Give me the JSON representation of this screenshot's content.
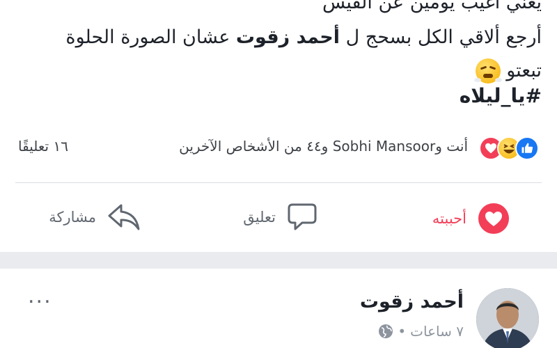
{
  "post": {
    "lines": {
      "line1": "يعني أغيب يومين عن الفيس",
      "line2_pre": "أرجع ألاقي الكل بسحج ل",
      "line2_name": "أحمد زقوت",
      "line2_post": "عشان الصورة الحلوة",
      "line3": "تبعتو",
      "hashtag": "#يا_ليلاه"
    },
    "emoji": "steam-from-nose-emoji"
  },
  "reactions": {
    "names_text": "أنت وSobhi Mansoor و٤٤ من الأشخاص الآخرين",
    "comments_text": "١٦ تعليقًا",
    "icons": [
      "like-reaction-icon",
      "haha-reaction-icon",
      "love-reaction-icon"
    ],
    "colors": {
      "like": "#1877f2",
      "love": "#f33e58",
      "haha": "#f6b000"
    }
  },
  "actions": {
    "like_label": "أحببته",
    "comment_label": "تعليق",
    "share_label": "مشاركة"
  },
  "next_post": {
    "author": "أحمد زقوت",
    "time": "٧ ساعات",
    "dot": "•",
    "more": "..."
  }
}
